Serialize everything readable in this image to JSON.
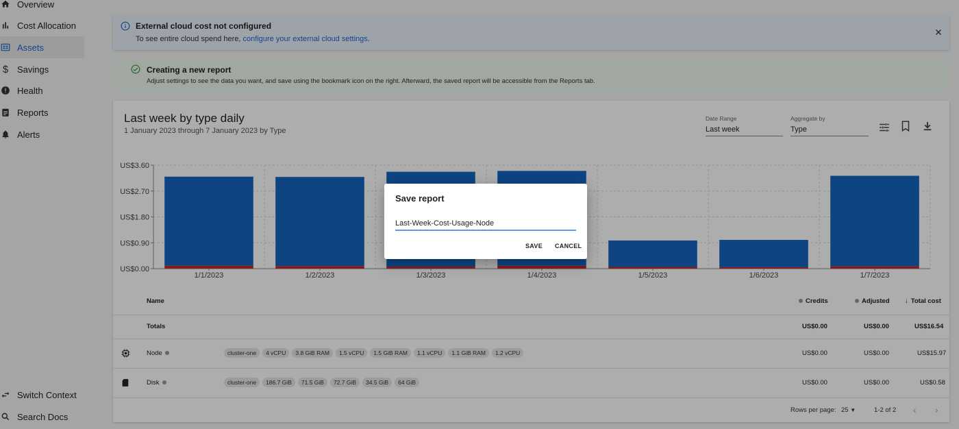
{
  "sidebar": {
    "items": [
      {
        "label": "Overview",
        "icon": "home-icon"
      },
      {
        "label": "Cost Allocation",
        "icon": "bar-chart-icon"
      },
      {
        "label": "Assets",
        "icon": "grid-icon"
      },
      {
        "label": "Savings",
        "icon": "dollar-icon"
      },
      {
        "label": "Health",
        "icon": "alert-circle-icon"
      },
      {
        "label": "Reports",
        "icon": "clipboard-icon"
      },
      {
        "label": "Alerts",
        "icon": "bell-icon"
      }
    ],
    "bottom_items": [
      {
        "label": "Switch Context",
        "icon": "swap-icon"
      },
      {
        "label": "Search Docs",
        "icon": "search-icon"
      }
    ],
    "active_color": "#1e66c8"
  },
  "alerts": {
    "info_title": "External cloud cost not configured",
    "info_body_prefix": "To see entire cloud spend here, ",
    "info_body_link": "configure your external cloud settings",
    "info_body_suffix": ".",
    "success_title": "Creating a new report",
    "success_body": "Adjust settings to see the data you want, and save using the bookmark icon on the right. Afterward, the saved report will be accessible from the Reports tab."
  },
  "report": {
    "title": "Last week by type daily",
    "subtitle": "1 January 2023 through 7 January 2023 by Type",
    "date_range_label": "Date Range",
    "date_range_value": "Last week",
    "aggregate_label": "Aggregate by",
    "aggregate_value": "Type"
  },
  "chart_data": {
    "type": "bar",
    "stacked": true,
    "categories": [
      "1/1/2023",
      "1/2/2023",
      "1/3/2023",
      "1/4/2023",
      "1/5/2023",
      "1/6/2023",
      "1/7/2023"
    ],
    "series": [
      {
        "name": "Node",
        "color": "#1565c0",
        "values": [
          3.1,
          3.1,
          3.3,
          3.3,
          0.92,
          0.95,
          3.15
        ]
      },
      {
        "name": "Disk",
        "color": "#c62828",
        "values": [
          0.1,
          0.09,
          0.07,
          0.1,
          0.06,
          0.05,
          0.08
        ]
      }
    ],
    "yticks": [
      "US$0.00",
      "US$0.90",
      "US$1.80",
      "US$2.70",
      "US$3.60"
    ],
    "ylim": [
      0,
      3.6
    ],
    "grid": true
  },
  "table": {
    "headers": {
      "name": "Name",
      "credits": "Credits",
      "adjusted": "Adjusted",
      "total": "Total cost"
    },
    "totals": {
      "label": "Totals",
      "credits": "US$0.00",
      "adjusted": "US$0.00",
      "total": "US$16.54"
    },
    "rows": [
      {
        "name": "Node",
        "icon": "cpu-icon",
        "chips": [
          "cluster-one",
          "4 vCPU",
          "3.8 GiB RAM",
          "1.5 vCPU",
          "1.5 GiB RAM",
          "1.1 vCPU",
          "1.1 GiB RAM",
          "1.2 vCPU"
        ],
        "credits": "US$0.00",
        "adjusted": "US$0.00",
        "total": "US$15.97"
      },
      {
        "name": "Disk",
        "icon": "disk-icon",
        "chips": [
          "cluster-one",
          "186.7 GiB",
          "71.5 GiB",
          "72.7 GiB",
          "34.5 GiB",
          "64 GiB"
        ],
        "credits": "US$0.00",
        "adjusted": "US$0.00",
        "total": "US$0.58"
      }
    ],
    "rows_per_page_label": "Rows per page:",
    "rows_per_page_value": "25",
    "range_text": "1-2 of 2"
  },
  "dialog": {
    "title": "Save report",
    "input_value": "Last-Week-Cost-Usage-Node",
    "save_label": "SAVE",
    "cancel_label": "CANCEL"
  }
}
